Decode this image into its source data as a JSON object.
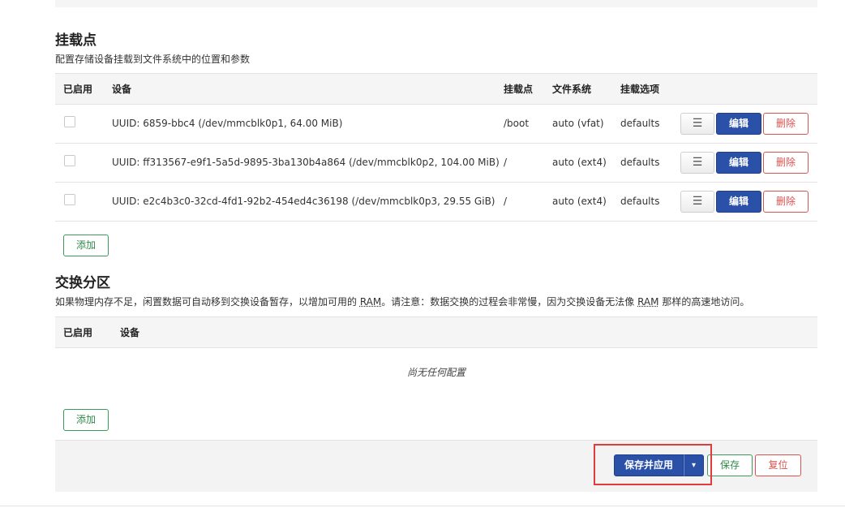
{
  "mounts": {
    "title": "挂载点",
    "description": "配置存储设备挂载到文件系统中的位置和参数",
    "headers": {
      "enabled": "已启用",
      "device": "设备",
      "mountpoint": "挂载点",
      "filesystem": "文件系统",
      "options": "挂载选项"
    },
    "rows": [
      {
        "enabled": false,
        "device": "UUID: 6859-bbc4 (/dev/mmcblk0p1, 64.00 MiB)",
        "mountpoint": "/boot",
        "filesystem": "auto (vfat)",
        "options": "defaults"
      },
      {
        "enabled": false,
        "device": "UUID: ff313567-e9f1-5a5d-9895-3ba130b4a864 (/dev/mmcblk0p2, 104.00 MiB)",
        "mountpoint": "/",
        "filesystem": "auto (ext4)",
        "options": "defaults"
      },
      {
        "enabled": false,
        "device": "UUID: e2c4b3c0-32cd-4fd1-92b2-454ed4c36198 (/dev/mmcblk0p3, 29.55 GiB)",
        "mountpoint": "/",
        "filesystem": "auto (ext4)",
        "options": "defaults"
      }
    ],
    "row_buttons": {
      "menu": "☰",
      "edit": "编辑",
      "delete": "删除"
    },
    "add_label": "添加"
  },
  "swap": {
    "title": "交换分区",
    "desc_part1": "如果物理内存不足，闲置数据可自动移到交换设备暂存，以增加可用的 ",
    "desc_ram1": "RAM",
    "desc_part2": "。请注意：数据交换的过程会非常慢，因为交换设备无法像 ",
    "desc_ram2": "RAM",
    "desc_part3": " 那样的高速地访问。",
    "headers": {
      "enabled": "已启用",
      "device": "设备"
    },
    "empty": "尚无任何配置",
    "add_label": "添加"
  },
  "footer": {
    "save_apply": "保存并应用",
    "dropdown": "▾",
    "save": "保存",
    "reset": "复位"
  }
}
